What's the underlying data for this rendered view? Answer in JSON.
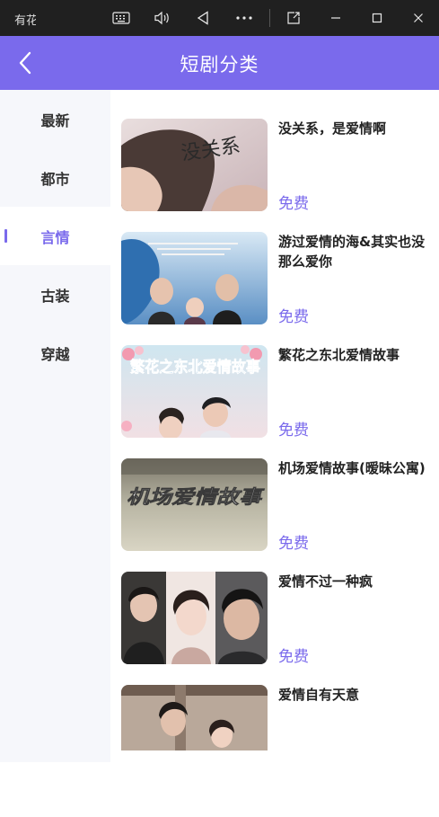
{
  "titlebar": {
    "app_name": "有花",
    "buttons": [
      "keyboard-icon",
      "volume-icon",
      "back-triangle-icon",
      "more-icon",
      "pip-icon",
      "minimize-icon",
      "maximize-icon",
      "close-icon"
    ]
  },
  "header": {
    "title": "短剧分类",
    "background": "#7a6aec"
  },
  "sidebar": {
    "categories": [
      {
        "label": "最新",
        "active": false
      },
      {
        "label": "都市",
        "active": false
      },
      {
        "label": "言情",
        "active": true
      },
      {
        "label": "古装",
        "active": false
      },
      {
        "label": "穿越",
        "active": false
      }
    ]
  },
  "dramas": [
    {
      "title": "没关系，是爱情啊",
      "price": "免费",
      "poster_text": "没关系"
    },
    {
      "title": "游过爱情的海&其实也没那么爱你",
      "price": "免费",
      "poster_text": ""
    },
    {
      "title": "繁花之东北爱情故事",
      "price": "免费",
      "poster_text": "繁花之东北爱情故事"
    },
    {
      "title": "机场爱情故事(暧昧公寓)",
      "price": "免费",
      "poster_text": "机场爱情故事"
    },
    {
      "title": "爱情不过一种疯",
      "price": "免费",
      "poster_text": ""
    },
    {
      "title": "爱情自有天意",
      "price": "",
      "poster_text": ""
    }
  ],
  "colors": {
    "accent": "#7a6aec",
    "sidebar_bg": "#f6f7fb",
    "titlebar_bg": "#202020"
  }
}
